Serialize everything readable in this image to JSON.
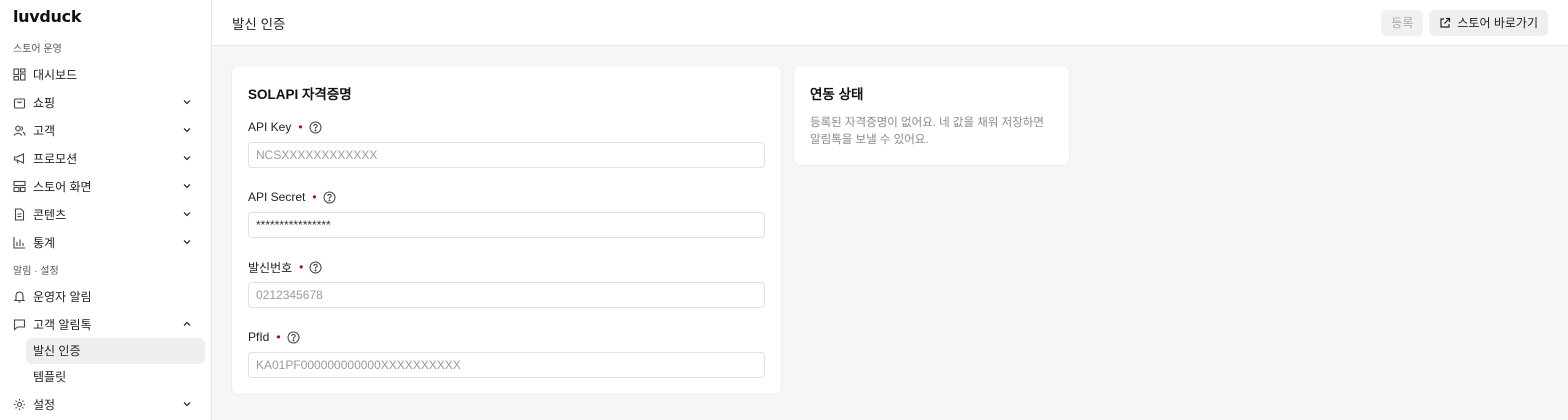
{
  "brand": {
    "logo": "luvduck"
  },
  "sidebar": {
    "section1": "스토어 운영",
    "items1": [
      {
        "label": "대시보드",
        "icon": "dashboard-icon",
        "chevron": false
      },
      {
        "label": "쇼핑",
        "icon": "shopping-bag-icon",
        "chevron": true
      },
      {
        "label": "고객",
        "icon": "users-icon",
        "chevron": true
      },
      {
        "label": "프로모션",
        "icon": "megaphone-icon",
        "chevron": true
      },
      {
        "label": "스토어 화면",
        "icon": "layout-icon",
        "chevron": true
      },
      {
        "label": "콘텐츠",
        "icon": "document-icon",
        "chevron": true
      },
      {
        "label": "통계",
        "icon": "bar-chart-icon",
        "chevron": true
      }
    ],
    "section2": "알림 · 설정",
    "items2": [
      {
        "label": "운영자 알림",
        "icon": "bell-icon",
        "chevron": false
      },
      {
        "label": "고객 알림톡",
        "icon": "message-icon",
        "chevron": "up"
      }
    ],
    "subitems": [
      {
        "label": "발신 인증",
        "active": true
      },
      {
        "label": "템플릿",
        "active": false
      }
    ],
    "settings": {
      "label": "설정",
      "icon": "gear-icon"
    }
  },
  "header": {
    "title": "발신 인증",
    "register_label": "등록",
    "store_link_label": "스토어 바로가기"
  },
  "form": {
    "title": "SOLAPI 자격증명",
    "fields": [
      {
        "label": "API Key",
        "placeholder": "NCSXXXXXXXXXXXX",
        "value": ""
      },
      {
        "label": "API Secret",
        "placeholder": "",
        "value": "****************"
      },
      {
        "label": "발신번호",
        "placeholder": "0212345678",
        "value": ""
      },
      {
        "label": "PfId",
        "placeholder": "KA01PF000000000000XXXXXXXXXX",
        "value": ""
      }
    ],
    "required_mark": "•"
  },
  "status": {
    "title": "연동 상태",
    "message": "등록된 자격증명이 없어요. 네 값을 채워 저장하면 알림톡을 보낼 수 있어요."
  },
  "colors": {
    "required": "#b3003b",
    "active_bg": "#eeeef0"
  }
}
